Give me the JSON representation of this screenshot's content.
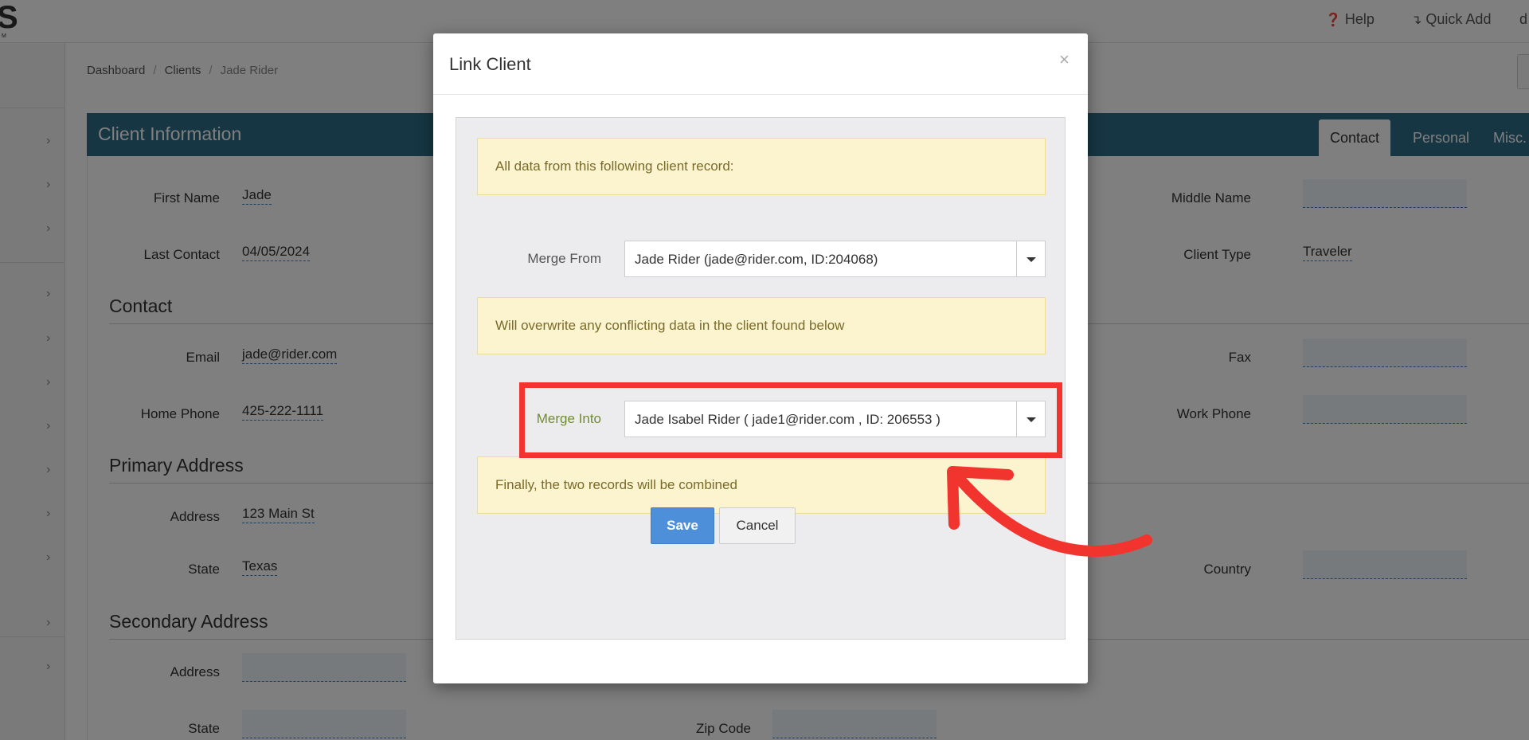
{
  "app": {
    "logo_text": "S",
    "logo_tm": "M"
  },
  "topbar": {
    "help_label": "Help",
    "quick_add_label": "Quick Add",
    "user_initial": "d"
  },
  "breadcrumb": {
    "items": [
      "Dashboard",
      "Clients",
      "Jade Rider"
    ]
  },
  "panel": {
    "title": "Client Information",
    "tabs": [
      "Contact",
      "Personal",
      "Misc."
    ]
  },
  "fields": {
    "first_name": {
      "label": "First Name",
      "value": "Jade"
    },
    "last_contact": {
      "label": "Last Contact",
      "value": "04/05/2024"
    },
    "middle_name": {
      "label": "Middle Name"
    },
    "client_type": {
      "label": "Client Type",
      "value": "Traveler"
    },
    "email": {
      "label": "Email",
      "value": "jade@rider.com"
    },
    "home_phone": {
      "label": "Home Phone",
      "value": "425-222-1111"
    },
    "fax": {
      "label": "Fax"
    },
    "work_phone": {
      "label": "Work Phone"
    },
    "address": {
      "label": "Address",
      "value": "123 Main St"
    },
    "state": {
      "label": "State",
      "value": "Texas"
    },
    "country": {
      "label": "Country"
    },
    "sec_address": {
      "label": "Address"
    },
    "sec_state": {
      "label": "State"
    },
    "sec_zip": {
      "label": "Zip Code"
    }
  },
  "sections": {
    "contact": "Contact",
    "primary_address": "Primary Address",
    "secondary_address": "Secondary Address"
  },
  "modal": {
    "title": "Link Client",
    "close": "×",
    "alert1": "All data from this following client record:",
    "merge_from_label": "Merge From",
    "merge_from_value": "Jade Rider (jade@rider.com, ID:204068)",
    "alert2": "Will overwrite any conflicting data in the client found below",
    "merge_into_label": "Merge Into",
    "merge_into_value": "Jade Isabel Rider ( jade1@rider.com , ID: 206553 )",
    "alert3": "Finally, the two records will be combined",
    "save_label": "Save",
    "cancel_label": "Cancel"
  },
  "colors": {
    "panel_header": "#2d6c86",
    "save_button": "#4d8fd9",
    "alert_bg": "#fcf4cf",
    "annotation_red": "#f1352e"
  },
  "icons": {
    "help": "question-circle-icon",
    "quick_add": "level-down-icon",
    "chevron": "chevron-right-icon",
    "caret": "caret-down-icon"
  }
}
